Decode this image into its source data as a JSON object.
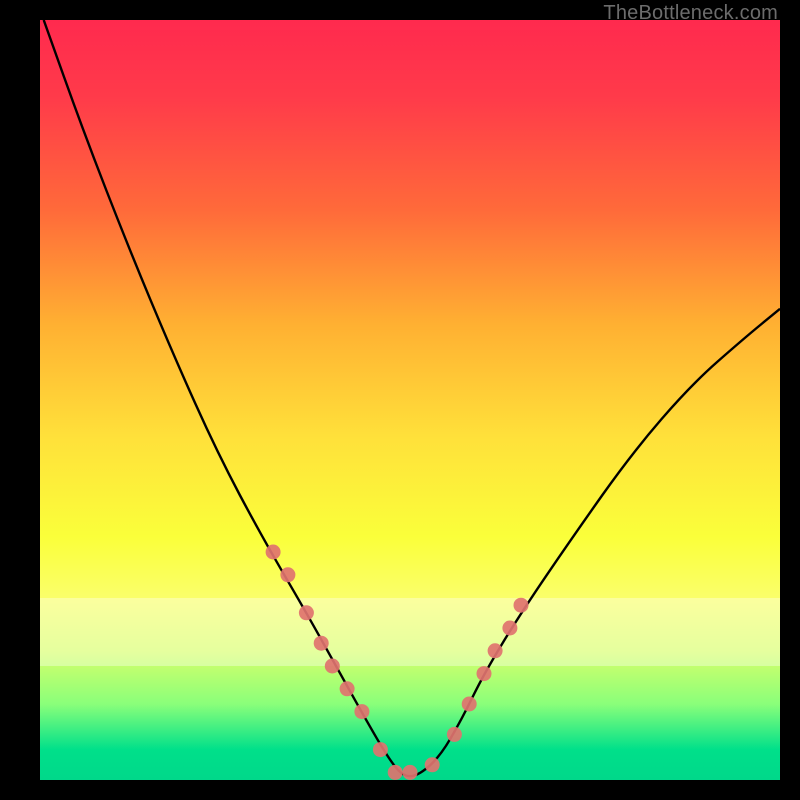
{
  "attribution": "TheBottleneck.com",
  "colors": {
    "background": "#000000",
    "gradient_top": "#ff2a4e",
    "gradient_bottom": "#00d88a",
    "curve": "#000000",
    "markers": "#e0736f"
  },
  "chart_data": {
    "type": "line",
    "title": "",
    "xlabel": "",
    "ylabel": "",
    "ylim": [
      0,
      100
    ],
    "xlim": [
      0,
      100
    ],
    "series": [
      {
        "name": "curve",
        "x": [
          0.5,
          6,
          12,
          18,
          24,
          30,
          36,
          40,
          44,
          47,
          49,
          51,
          54,
          57,
          60,
          65,
          72,
          80,
          88,
          95,
          100
        ],
        "values": [
          100,
          85,
          70,
          56,
          43,
          32,
          22,
          15,
          8,
          3,
          0.5,
          0.5,
          3,
          8,
          14,
          22,
          32,
          43,
          52,
          58,
          62
        ]
      }
    ],
    "markers": {
      "x": [
        31.5,
        33.5,
        36,
        38,
        39.5,
        41.5,
        43.5,
        46,
        48,
        50,
        53,
        56,
        58,
        60,
        61.5,
        63.5,
        65
      ],
      "values": [
        30,
        27,
        22,
        18,
        15,
        12,
        9,
        4,
        1,
        1,
        2,
        6,
        10,
        14,
        17,
        20,
        23
      ]
    }
  }
}
